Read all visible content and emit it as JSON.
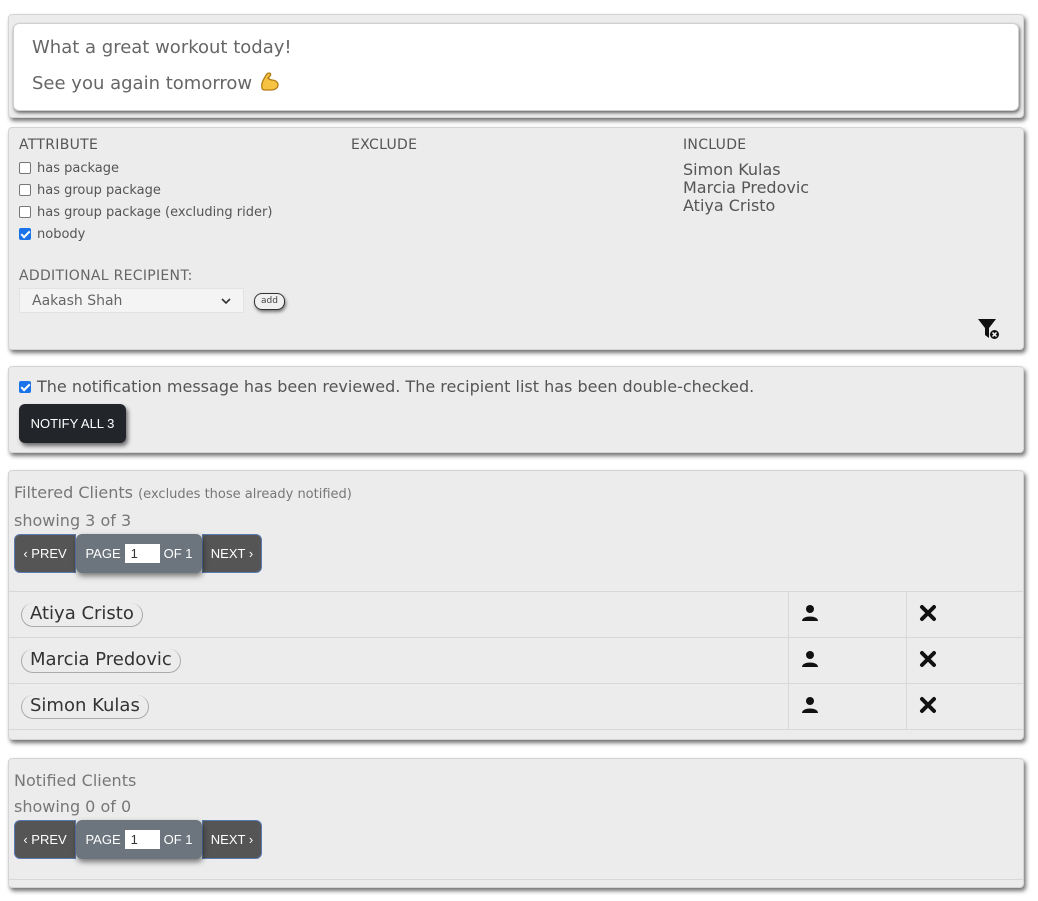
{
  "message": {
    "line1": "What a great workout today!",
    "line2": "See you again tomorrow",
    "emoji": "flexed-biceps-icon"
  },
  "filters": {
    "attribute_title": "ATTRIBUTE",
    "exclude_title": "EXCLUDE",
    "include_title": "INCLUDE",
    "attributes": [
      {
        "label": "has package",
        "checked": false
      },
      {
        "label": "has group package",
        "checked": false
      },
      {
        "label": "has group package (excluding rider)",
        "checked": false
      },
      {
        "label": "nobody",
        "checked": true
      }
    ],
    "include": [
      "Simon Kulas",
      "Marcia Predovic",
      "Atiya Cristo"
    ],
    "additional_recipient_label": "ADDITIONAL RECIPIENT:",
    "additional_recipient_value": "Aakash Shah",
    "add_label": "add",
    "clear_filter_icon": "filter-clear-icon"
  },
  "notify": {
    "reviewed_text": "The notification message has been reviewed. The recipient list has been double-checked.",
    "reviewed_checked": true,
    "button_label": "NOTIFY ALL 3"
  },
  "filtered": {
    "title": "Filtered Clients",
    "subtitle": "(excludes those already notified)",
    "showing": "showing 3 of 3",
    "pager": {
      "prev": "‹ PREV",
      "page": "PAGE",
      "page_value": "1",
      "of": "OF 1",
      "next": "NEXT ›"
    },
    "clients": [
      "Atiya Cristo",
      "Marcia Predovic",
      "Simon Kulas"
    ]
  },
  "notified": {
    "title": "Notified Clients",
    "showing": "showing 0 of 0",
    "pager": {
      "prev": "‹ PREV",
      "page": "PAGE",
      "page_value": "1",
      "of": "OF 1",
      "next": "NEXT ›"
    }
  },
  "colors": {
    "accent": "#1a73e8",
    "dark_button": "#22262a",
    "pager_mid": "#6c757d"
  }
}
